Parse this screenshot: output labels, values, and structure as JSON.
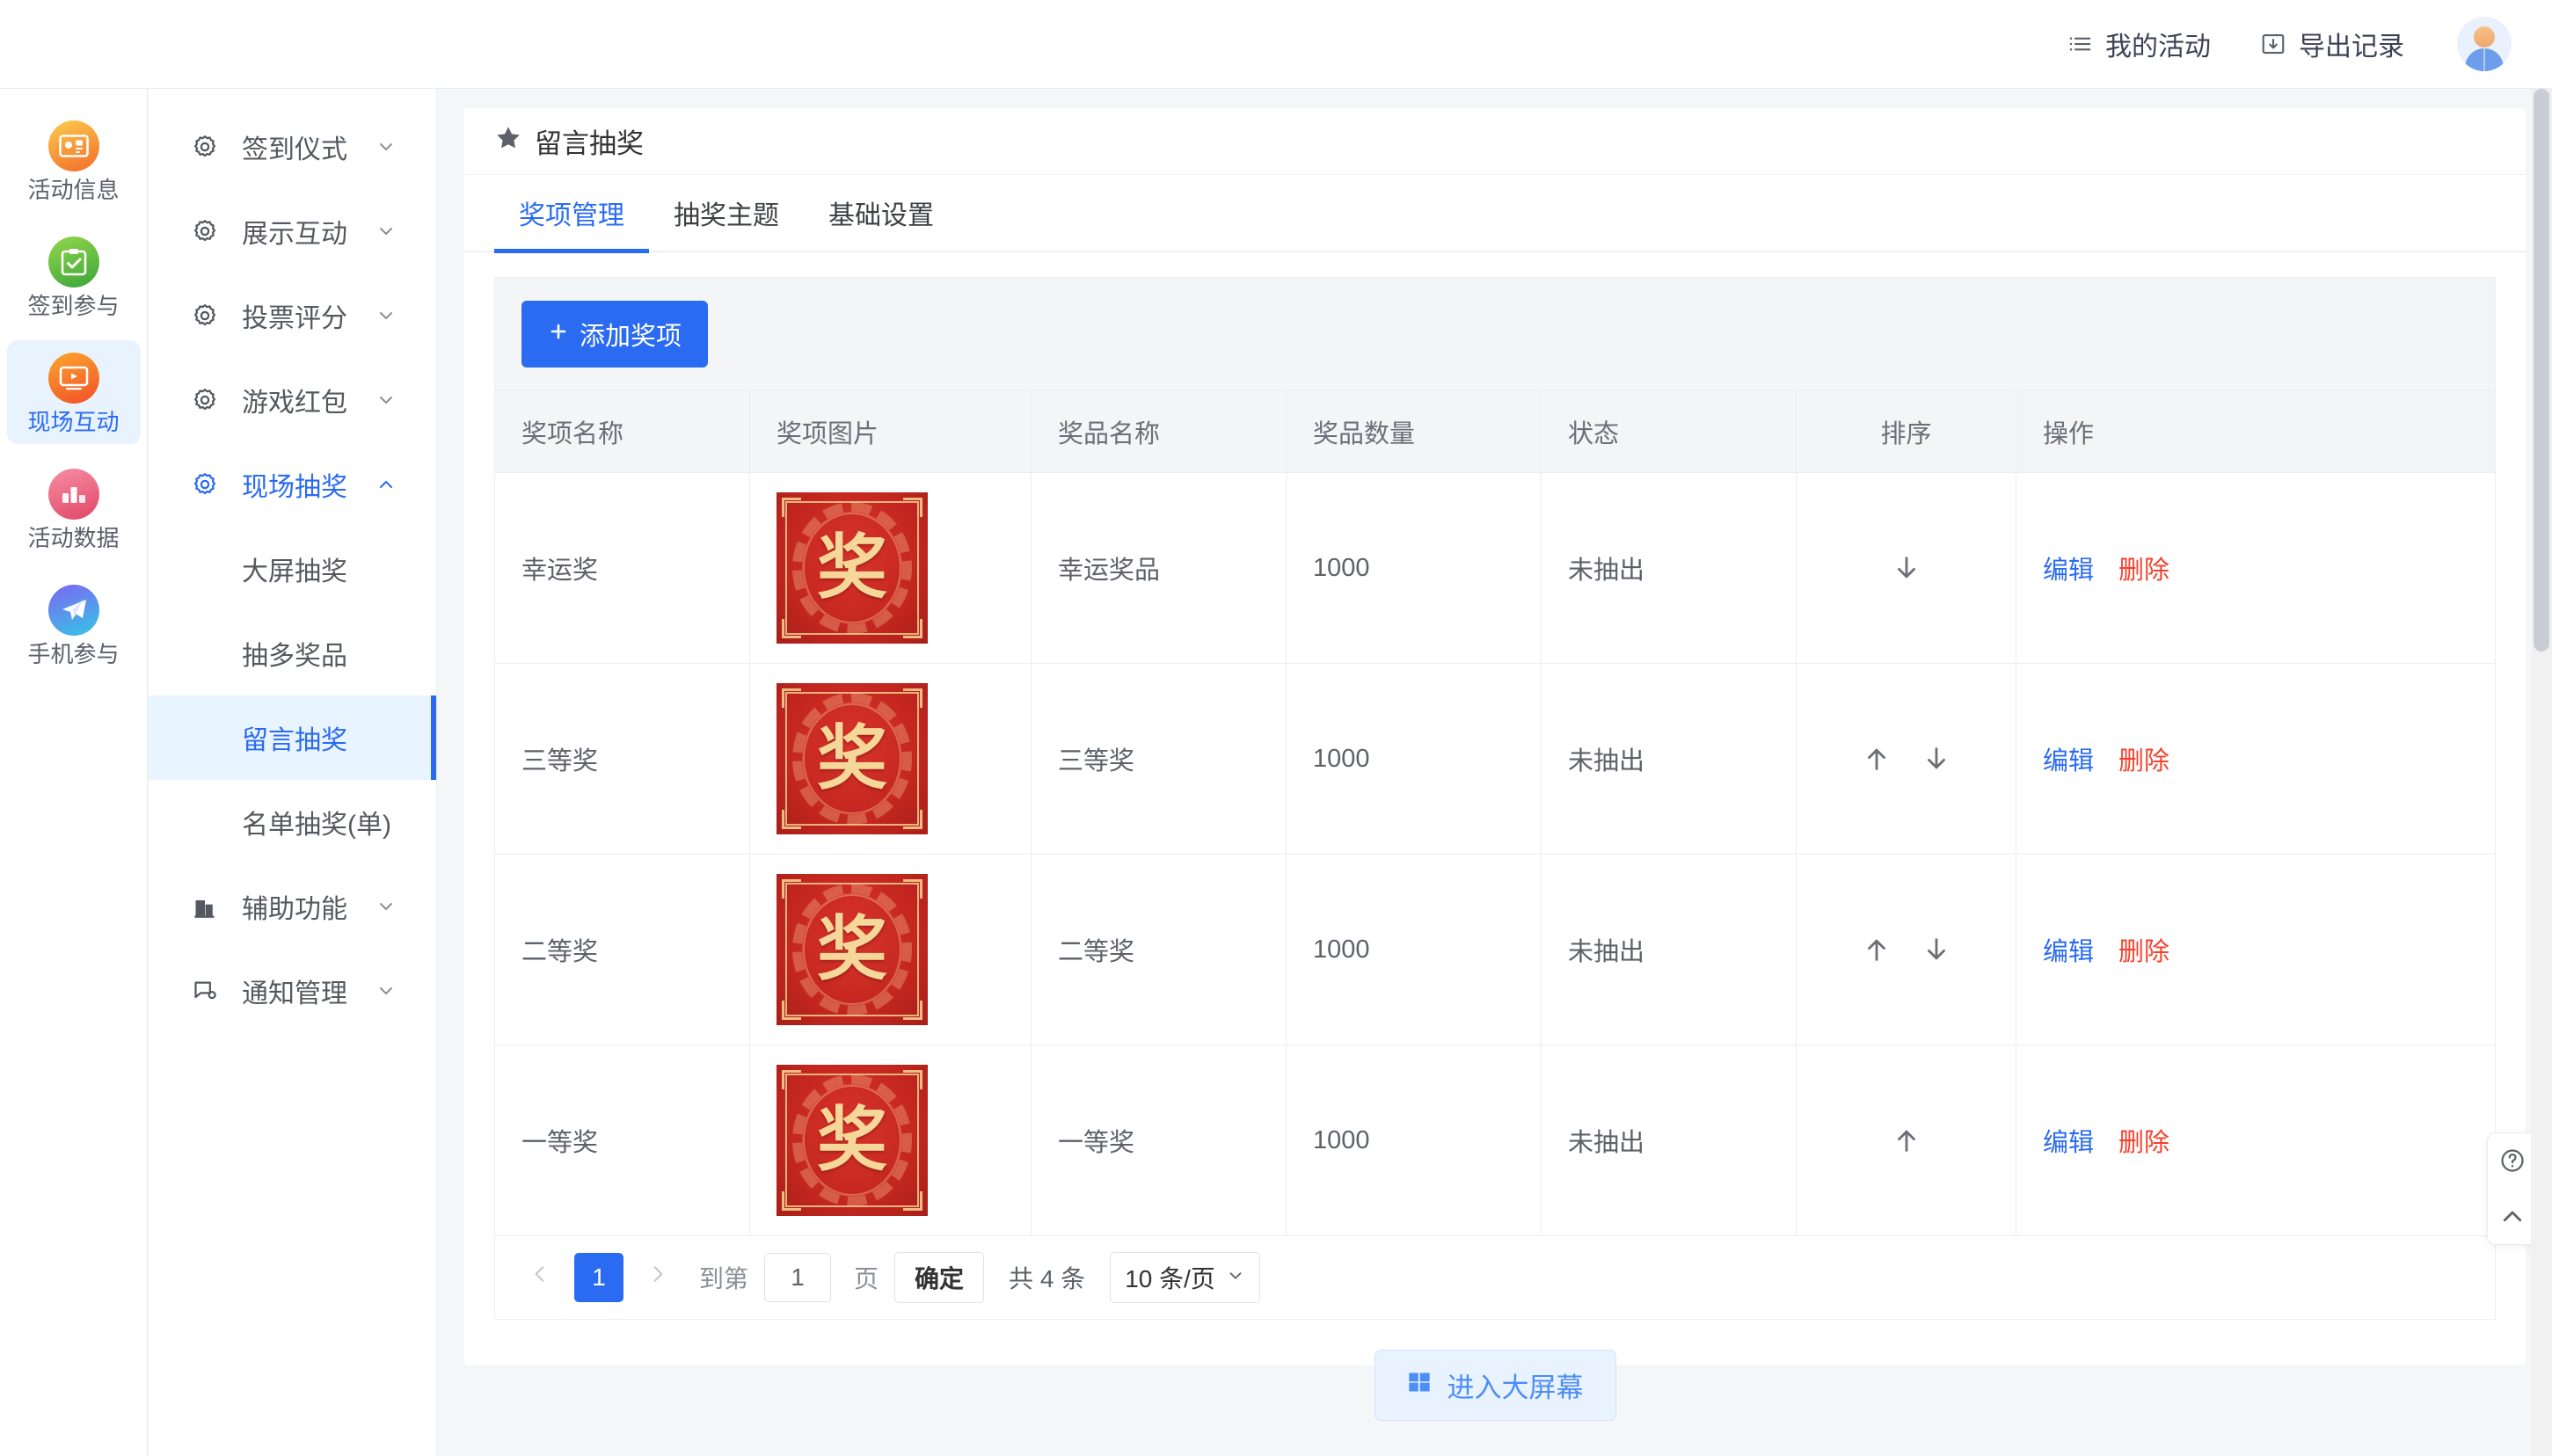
{
  "header": {
    "my_activities": "我的活动",
    "export_records": "导出记录"
  },
  "rail": {
    "items": [
      {
        "label": "活动信息",
        "icon": "id-card-icon",
        "active": false
      },
      {
        "label": "签到参与",
        "icon": "clipboard-check-icon",
        "active": false
      },
      {
        "label": "现场互动",
        "icon": "video-play-icon",
        "active": true
      },
      {
        "label": "活动数据",
        "icon": "bar-chart-icon",
        "active": false
      },
      {
        "label": "手机参与",
        "icon": "paper-plane-icon",
        "active": false
      }
    ]
  },
  "submenu": {
    "groups": [
      {
        "label": "签到仪式",
        "icon": "gear-icon",
        "open": false
      },
      {
        "label": "展示互动",
        "icon": "gear-icon",
        "open": false
      },
      {
        "label": "投票评分",
        "icon": "gear-icon",
        "open": false
      },
      {
        "label": "游戏红包",
        "icon": "gear-icon",
        "open": false
      },
      {
        "label": "现场抽奖",
        "icon": "gear-icon",
        "open": true
      }
    ],
    "children": [
      {
        "label": "大屏抽奖",
        "active": false
      },
      {
        "label": "抽多奖品",
        "active": false
      },
      {
        "label": "留言抽奖",
        "active": true
      },
      {
        "label": "名单抽奖(单)",
        "active": false
      }
    ],
    "tail_groups": [
      {
        "label": "辅助功能",
        "icon": "building-icon",
        "open": false
      },
      {
        "label": "通知管理",
        "icon": "message-gear-icon",
        "open": false
      }
    ]
  },
  "page": {
    "title": "留言抽奖",
    "title_icon": "star-icon",
    "tabs": [
      {
        "label": "奖项管理",
        "active": true
      },
      {
        "label": "抽奖主题",
        "active": false
      },
      {
        "label": "基础设置",
        "active": false
      }
    ],
    "add_button": "添加奖项",
    "add_button_icon": "plus-icon"
  },
  "table": {
    "columns": [
      "奖项名称",
      "奖项图片",
      "奖品名称",
      "奖品数量",
      "状态",
      "排序",
      "操作"
    ],
    "prize_image_glyph": "奖",
    "rows": [
      {
        "name": "幸运奖",
        "prize": "幸运奖品",
        "qty": "1000",
        "state": "未抽出",
        "sort_up": false,
        "sort_down": true,
        "edit": "编辑",
        "delete": "删除"
      },
      {
        "name": "三等奖",
        "prize": "三等奖",
        "qty": "1000",
        "state": "未抽出",
        "sort_up": true,
        "sort_down": true,
        "edit": "编辑",
        "delete": "删除"
      },
      {
        "name": "二等奖",
        "prize": "二等奖",
        "qty": "1000",
        "state": "未抽出",
        "sort_up": true,
        "sort_down": true,
        "edit": "编辑",
        "delete": "删除"
      },
      {
        "name": "一等奖",
        "prize": "一等奖",
        "qty": "1000",
        "state": "未抽出",
        "sort_up": true,
        "sort_down": false,
        "edit": "编辑",
        "delete": "删除"
      }
    ]
  },
  "pagination": {
    "current_page": "1",
    "goto_label": "到第",
    "goto_value": "1",
    "page_unit": "页",
    "confirm": "确定",
    "total": "共 4 条",
    "page_size": "10 条/页"
  },
  "footer": {
    "bigscreen_button": "进入大屏幕",
    "bigscreen_icon": "windows-icon"
  },
  "helper": {
    "help_icon": "question-circle-icon",
    "top_icon": "chevron-up-icon"
  },
  "colors": {
    "primary": "#2a6bf2",
    "danger": "#f5412d",
    "prize_red": "#c2261f",
    "prize_gold": "#f6d79a"
  }
}
